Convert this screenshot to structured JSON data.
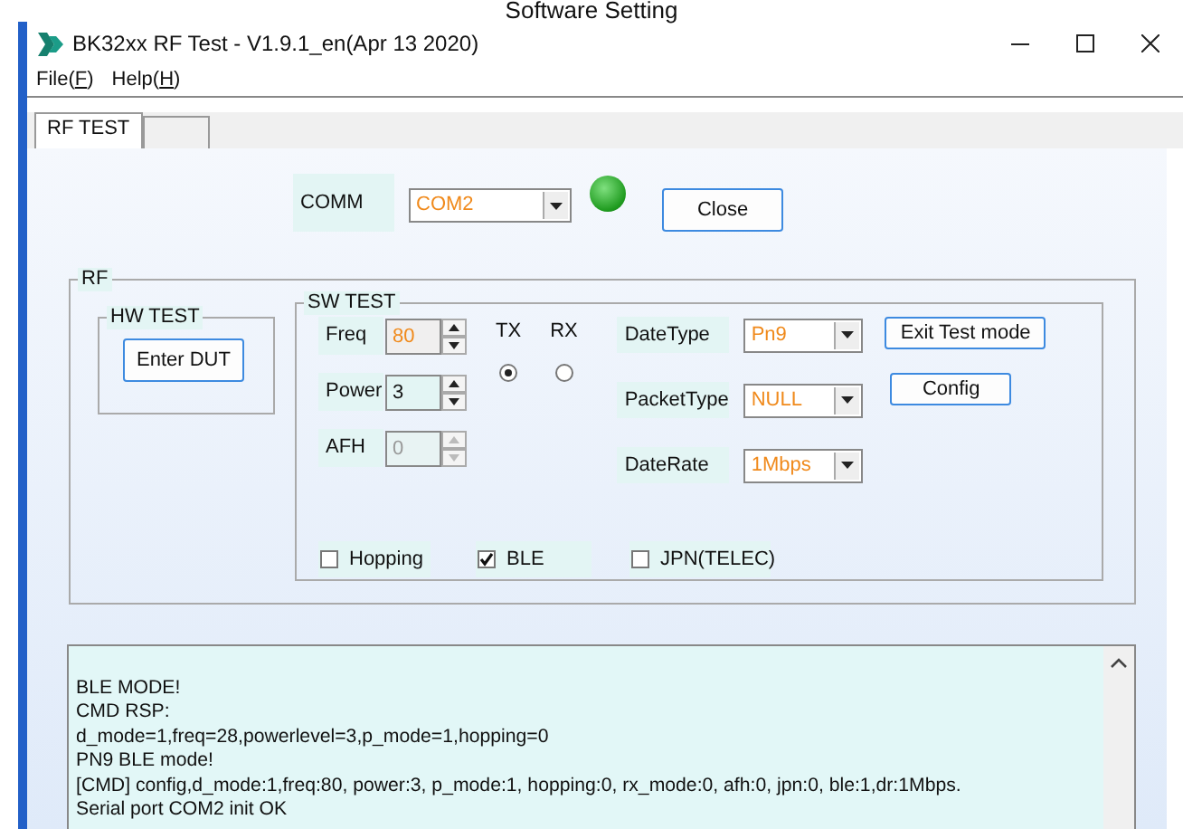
{
  "heading": "Software Setting",
  "window": {
    "title": "BK32xx RF Test - V1.9.1_en(Apr 13 2020)"
  },
  "menu": [
    {
      "before": "File(",
      "access_key": "F",
      "after": ")"
    },
    {
      "before": "Help(",
      "access_key": "H",
      "after": ")"
    }
  ],
  "tabs": [
    {
      "label": "RF TEST",
      "selected": true
    },
    {
      "selected": false
    }
  ],
  "comm": {
    "label": "COMM",
    "value": "COM2",
    "connected": true,
    "button": "Close"
  },
  "rf": {
    "title": "RF",
    "hw_test": {
      "title": "HW TEST",
      "button": "Enter DUT"
    },
    "sw_test": {
      "title": "SW TEST",
      "spinners": [
        {
          "label": "Freq",
          "value": "80",
          "accent": true,
          "disabled": false
        },
        {
          "label": "Power",
          "value": "3",
          "accent": false,
          "disabled": false
        },
        {
          "label": "AFH",
          "value": "0",
          "accent": false,
          "disabled": true
        }
      ],
      "radios": [
        {
          "label": "TX",
          "selected": true
        },
        {
          "label": "RX",
          "selected": false
        }
      ],
      "combos": [
        {
          "label": "DateType",
          "value": "Pn9"
        },
        {
          "label": "PacketType",
          "value": "NULL"
        },
        {
          "label": "DateRate",
          "value": "1Mbps"
        }
      ],
      "buttons": [
        "Exit Test mode",
        "Config"
      ],
      "checkboxes": [
        {
          "label": "Hopping",
          "checked": false
        },
        {
          "label": "BLE",
          "checked": true
        },
        {
          "label": "JPN(TELEC)",
          "checked": false
        }
      ]
    }
  },
  "log": [
    "BLE MODE!",
    "CMD RSP:",
    "d_mode=1,freq=28,powerlevel=3,p_mode=1,hopping=0",
    "PN9 BLE mode!",
    "[CMD] config,d_mode:1,freq:80, power:3, p_mode:1, hopping:0, rx_mode:0, afh:0, jpn:0, ble:1,dr:1Mbps.",
    "Serial port COM2 init OK"
  ]
}
